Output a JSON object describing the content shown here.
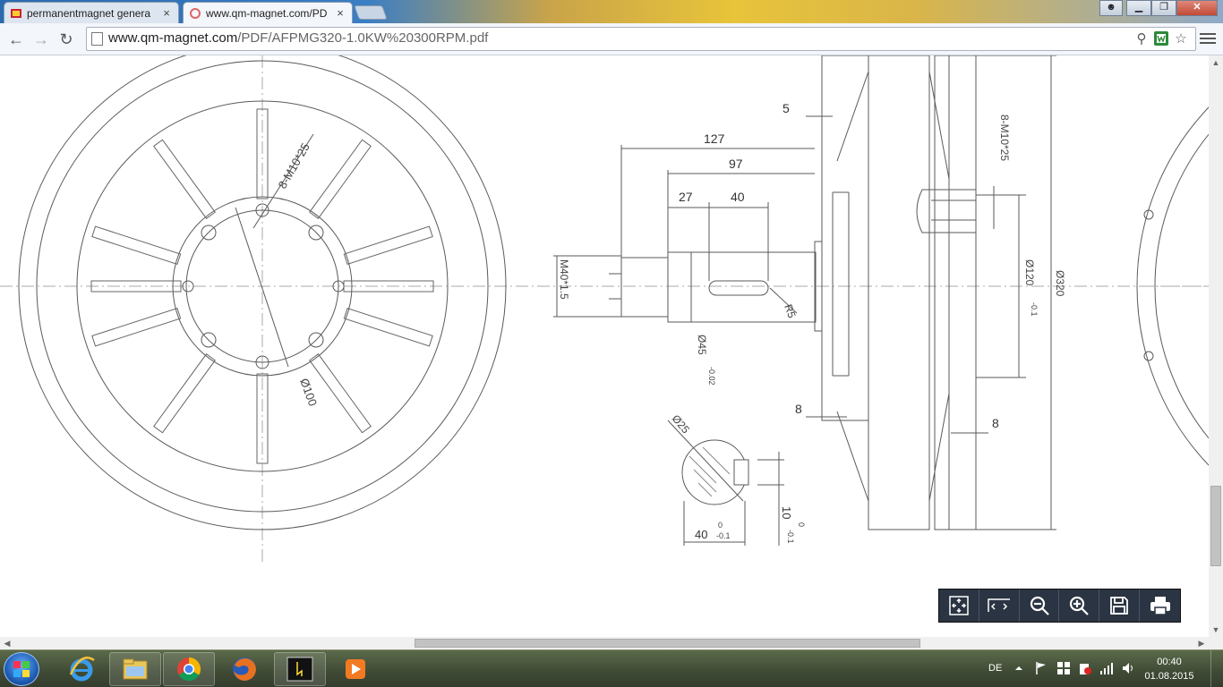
{
  "tabs": [
    {
      "title": "permanentmagnet genera",
      "close": "×",
      "active": false
    },
    {
      "title": "www.qm-magnet.com/PD",
      "close": "×",
      "active": true
    }
  ],
  "window_controls": {
    "minimize": "▁",
    "maximize": "❐",
    "close": "✕"
  },
  "toolbar": {
    "back": "←",
    "forward": "→",
    "reload": "↻"
  },
  "address": {
    "host": "www.qm-magnet.com",
    "path": "/PDF/AFPMG320-1.0KW%20300RPM.pdf"
  },
  "drawing": {
    "dims": {
      "d127": "127",
      "d97": "97",
      "d5": "5",
      "d27": "27",
      "d40": "40",
      "m40": "M40*1.5",
      "r5": "R5",
      "d45": "Ø45",
      "d45tol": "-0.02",
      "d8a": "8",
      "d8b": "8",
      "m10r": "8-M10*25",
      "m10l": "8-M10*25",
      "d120": "Ø120",
      "d120tol": "-0.1",
      "d320": "Ø320",
      "d100": "Ø100",
      "d25": "Ø25",
      "d40b": "40",
      "d40btol": "-0.1",
      "d10": "10",
      "d10tol": "-0.1",
      "tol0": "0"
    }
  },
  "pdf_toolbar": [
    "fit-page",
    "fit-width",
    "zoom-out",
    "zoom-in",
    "save",
    "print"
  ],
  "taskbar": {
    "apps": [
      "internet-explorer",
      "file-explorer",
      "chrome",
      "firefox",
      "terminal-app",
      "media-player"
    ],
    "language": "DE",
    "time": "00:40",
    "date": "01.08.2015"
  },
  "colors": {
    "drawing_line": "#555555",
    "pdf_toolbar": "#2a3442",
    "taskbar": "#3f4a35"
  }
}
